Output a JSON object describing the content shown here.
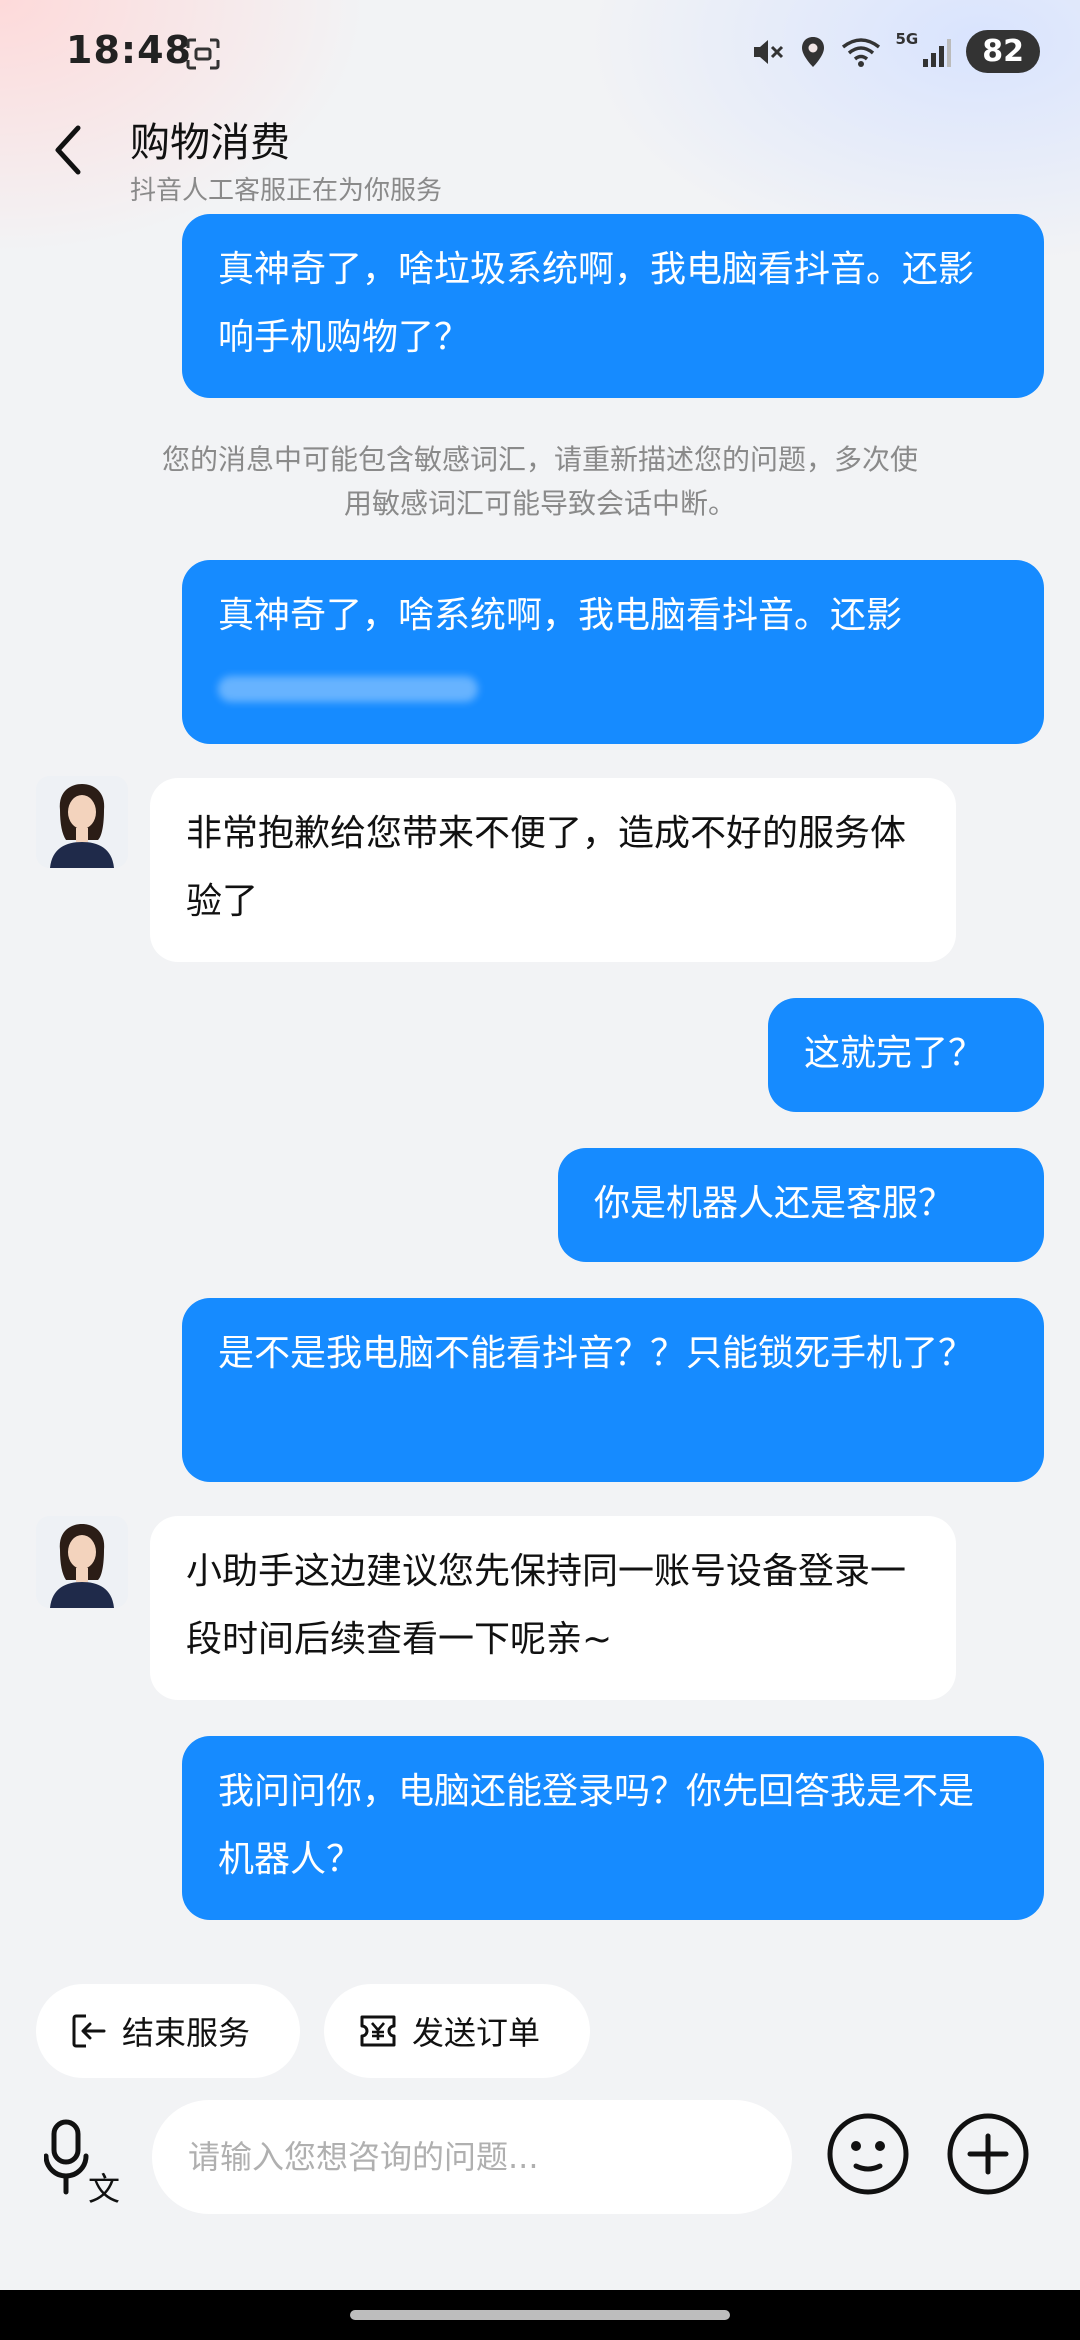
{
  "status_bar": {
    "time": "18:48",
    "network": "5G",
    "battery": "82"
  },
  "header": {
    "title": "购物消费",
    "subtitle": "抖音人工客服正在为你服务"
  },
  "messages": [
    {
      "sender": "me",
      "text": "真神奇了，啥垃圾系统啊，我电脑看抖音。还影响手机购物了？"
    },
    {
      "sender": "system",
      "text": "您的消息中可能包含敏感词汇，请重新描述您的问题，多次使用敏感词汇可能导致会话中断。"
    },
    {
      "sender": "me",
      "text": "真神奇了，啥系统啊，我电脑看抖音。还影"
    },
    {
      "sender": "bot",
      "text": "非常抱歉给您带来不便了，造成不好的服务体验了"
    },
    {
      "sender": "me",
      "text": "这就完了？"
    },
    {
      "sender": "me",
      "text": "你是机器人还是客服？"
    },
    {
      "sender": "me",
      "text": "是不是我电脑不能看抖音？？只能锁死手机了？"
    },
    {
      "sender": "bot",
      "text": "小助手这边建议您先保持同一账号设备登录一段时间后续查看一下呢亲~"
    },
    {
      "sender": "me",
      "text": "我问问你，电脑还能登录吗？你先回答我是不是机器人？"
    }
  ],
  "quick_actions": {
    "end_service": "结束服务",
    "send_order": "发送订单"
  },
  "input": {
    "placeholder": "请输入您想咨询的问题..."
  },
  "icons": {
    "back": "back-arrow-icon",
    "voice": "voice-to-text-icon",
    "emoji": "emoji-icon",
    "plus": "plus-icon"
  },
  "colors": {
    "my_bubble": "#168bff",
    "bot_bubble": "#ffffff",
    "background": "#f2f3f5"
  }
}
